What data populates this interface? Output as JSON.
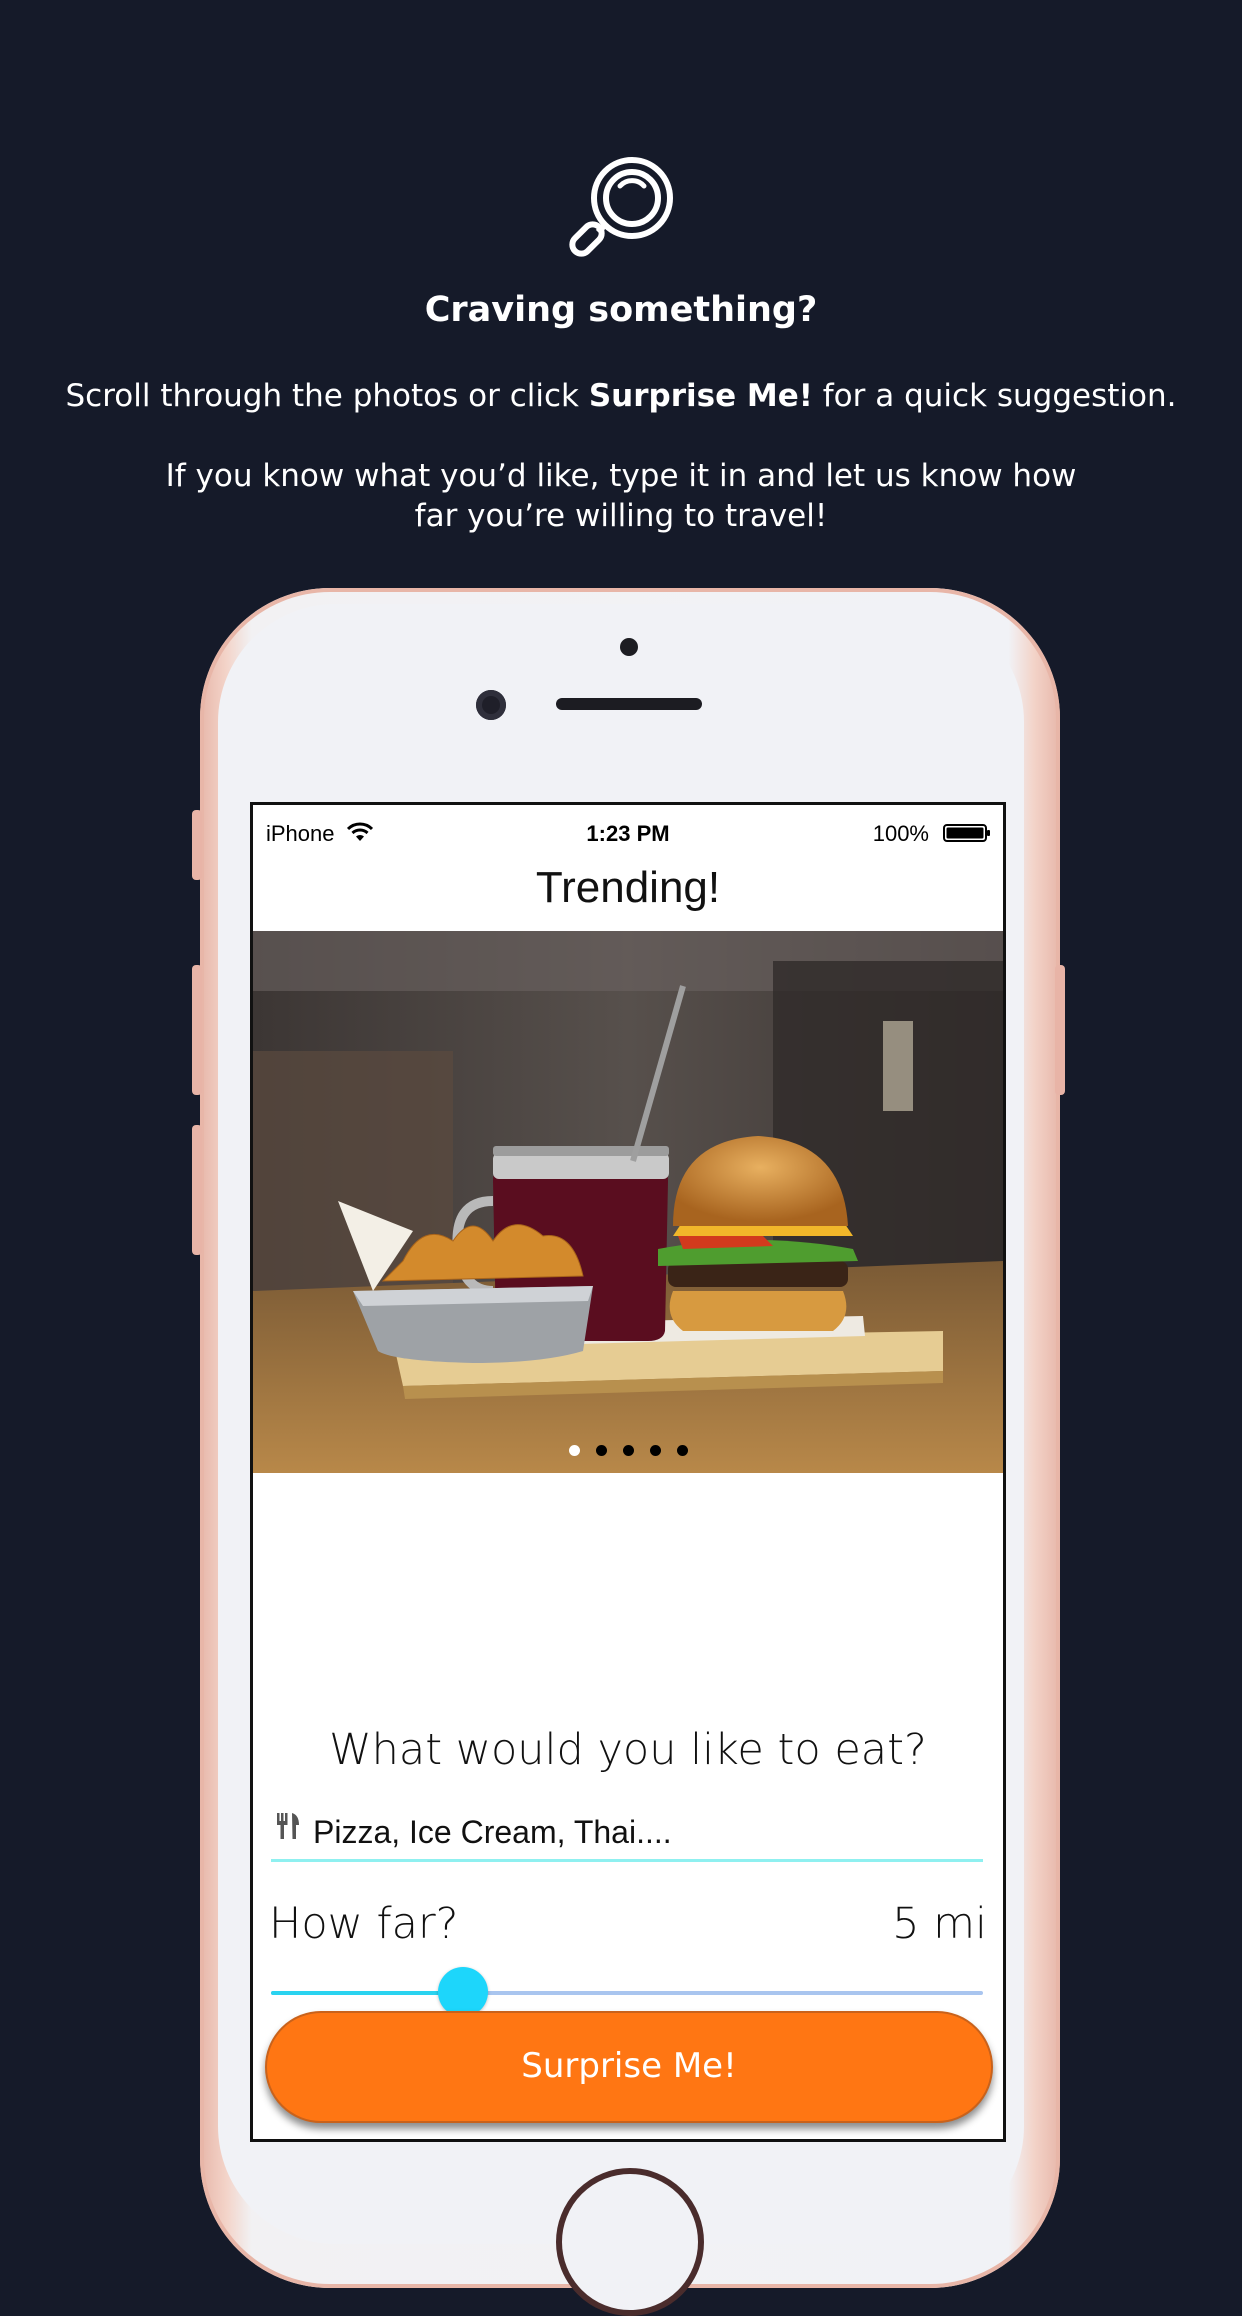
{
  "header": {
    "title": "Craving something?",
    "line1_prefix": "Scroll through the photos or click ",
    "line1_bold": "Surprise Me!",
    "line1_suffix": " for a quick suggestion.",
    "line2": "If you know what you’d like, type it in and let us know how",
    "line3": "far you’re willing to travel!"
  },
  "status_bar": {
    "carrier": "iPhone",
    "time": "1:23 PM",
    "battery": "100%"
  },
  "screen": {
    "title": "Trending!",
    "carousel": {
      "page_count": 5,
      "active_page": 1
    },
    "question": "What would you like to eat?",
    "food_input": {
      "placeholder": "Pizza, Ice Cream, Thai....",
      "value": ""
    },
    "how_far_label": "How far?",
    "distance_value": "5 mi",
    "slider_fraction": 0.27,
    "surprise_button": "Surprise Me!"
  },
  "colors": {
    "background": "#151a29",
    "accent_orange": "#ff7613",
    "slider_cyan": "#1dd6fb"
  },
  "icons": [
    "magnifier-icon",
    "wifi-icon",
    "battery-icon",
    "fork-knife-icon"
  ]
}
